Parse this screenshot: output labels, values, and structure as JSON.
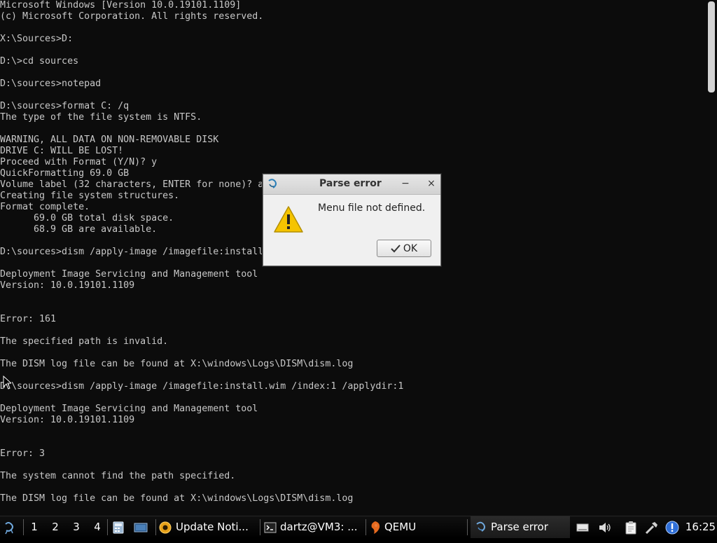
{
  "console": {
    "lines": [
      "Microsoft Windows [Version 10.0.19101.1109]",
      "(c) Microsoft Corporation. All rights reserved.",
      "",
      "X:\\Sources>D:",
      "",
      "D:\\>cd sources",
      "",
      "D:\\sources>notepad",
      "",
      "D:\\sources>format C: /q",
      "The type of the file system is NTFS.",
      "",
      "WARNING, ALL DATA ON NON-REMOVABLE DISK",
      "DRIVE C: WILL BE LOST!",
      "Proceed with Format (Y/N)? y",
      "QuickFormatting 69.0 GB",
      "Volume label (32 characters, ENTER for none)? a",
      "Creating file system structures.",
      "Format complete.",
      "      69.0 GB total disk space.",
      "      68.9 GB are available.",
      "",
      "D:\\sources>dism /apply-image /imagefile:install",
      "",
      "Deployment Image Servicing and Management tool",
      "Version: 10.0.19101.1109",
      "",
      "",
      "Error: 161",
      "",
      "The specified path is invalid.",
      "",
      "The DISM log file can be found at X:\\windows\\Logs\\DISM\\dism.log",
      "",
      "D:\\sources>dism /apply-image /imagefile:install.wim /index:1 /applydir:1",
      "",
      "Deployment Image Servicing and Management tool",
      "Version: 10.0.19101.1109",
      "",
      "",
      "Error: 3",
      "",
      "The system cannot find the path specified.",
      "",
      "The DISM log file can be found at X:\\windows\\Logs\\DISM\\dism.log"
    ]
  },
  "dialog": {
    "title": "Parse error",
    "minimize_label": "−",
    "close_label": "×",
    "message": "Menu file not defined.",
    "ok_label": "OK",
    "warning_icon": "warning-icon"
  },
  "taskbar": {
    "start_icon": "menu-icon",
    "workspaces": [
      "1",
      "2",
      "3",
      "4"
    ],
    "quicklaunch": [
      "calculator-icon",
      "desktop-icon"
    ],
    "tasks": [
      {
        "label": "Update Noti...",
        "icon": "update-notifier-icon"
      },
      {
        "label": "dartz@VM3: ...",
        "icon": "terminal-icon"
      },
      {
        "label": "QEMU",
        "icon": "qemu-icon"
      },
      {
        "label": "Parse error",
        "icon": "parse-error-app-icon",
        "active": true
      }
    ],
    "tray": [
      "drive-icon",
      "volume-icon",
      "clipboard-icon",
      "network-icon",
      "info-icon"
    ],
    "clock": "16:25"
  },
  "colors": {
    "console_bg": "#0c0c0c",
    "console_text": "#c8c8c8",
    "dialog_bg": "#f0f0f0",
    "warning_yellow": "#f5c400",
    "taskbar_bg": "#000000"
  }
}
